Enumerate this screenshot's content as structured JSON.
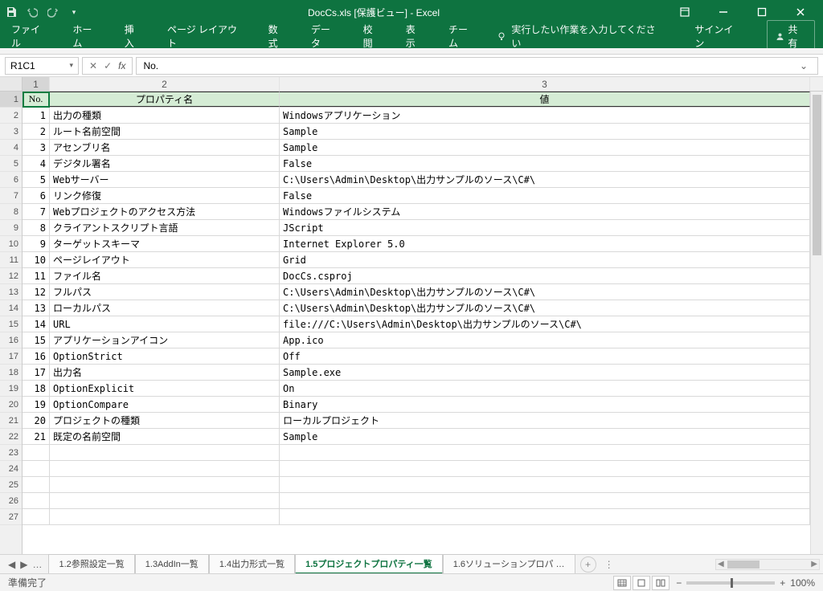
{
  "title": "DocCs.xls  [保護ビュー] - Excel",
  "ribbon": {
    "tabs": [
      "ファイル",
      "ホーム",
      "挿入",
      "ページ レイアウト",
      "数式",
      "データ",
      "校閲",
      "表示",
      "チーム"
    ],
    "tell": "実行したい作業を入力してください",
    "signin": "サインイン",
    "share": "共有"
  },
  "formula": {
    "name_box": "R1C1",
    "value": "No."
  },
  "col_headers": [
    "1",
    "2",
    "3"
  ],
  "hdr": {
    "c1": "No.",
    "c2": "プロパティ名",
    "c3": "値"
  },
  "rows": [
    {
      "n": "1",
      "p": "出力の種類",
      "v": "Windowsアプリケーション"
    },
    {
      "n": "2",
      "p": "ルート名前空間",
      "v": "Sample"
    },
    {
      "n": "3",
      "p": "アセンブリ名",
      "v": "Sample"
    },
    {
      "n": "4",
      "p": "デジタル署名",
      "v": "False"
    },
    {
      "n": "5",
      "p": "Webサーバー",
      "v": "C:\\Users\\Admin\\Desktop\\出力サンプルのソース\\C#\\"
    },
    {
      "n": "6",
      "p": "リンク修復",
      "v": "False"
    },
    {
      "n": "7",
      "p": "Webプロジェクトのアクセス方法",
      "v": "Windowsファイルシステム"
    },
    {
      "n": "8",
      "p": "クライアントスクリプト言語",
      "v": "JScript"
    },
    {
      "n": "9",
      "p": "ターゲットスキーマ",
      "v": "Internet Explorer 5.0"
    },
    {
      "n": "10",
      "p": "ページレイアウト",
      "v": "Grid"
    },
    {
      "n": "11",
      "p": "ファイル名",
      "v": "DocCs.csproj"
    },
    {
      "n": "12",
      "p": "フルパス",
      "v": "C:\\Users\\Admin\\Desktop\\出力サンプルのソース\\C#\\"
    },
    {
      "n": "13",
      "p": "ローカルパス",
      "v": "C:\\Users\\Admin\\Desktop\\出力サンプルのソース\\C#\\"
    },
    {
      "n": "14",
      "p": "URL",
      "v": "file:///C:\\Users\\Admin\\Desktop\\出力サンプルのソース\\C#\\"
    },
    {
      "n": "15",
      "p": "アプリケーションアイコン",
      "v": "App.ico"
    },
    {
      "n": "16",
      "p": "OptionStrict",
      "v": "Off"
    },
    {
      "n": "17",
      "p": "出力名",
      "v": "Sample.exe"
    },
    {
      "n": "18",
      "p": "OptionExplicit",
      "v": "On"
    },
    {
      "n": "19",
      "p": "OptionCompare",
      "v": "Binary"
    },
    {
      "n": "20",
      "p": "プロジェクトの種類",
      "v": "ローカルプロジェクト"
    },
    {
      "n": "21",
      "p": "既定の名前空間",
      "v": "Sample"
    }
  ],
  "empty_rows": 5,
  "sheet_tabs": {
    "items": [
      "1.2参照設定一覧",
      "1.3AddIn一覧",
      "1.4出力形式一覧",
      "1.5プロジェクトプロパティ一覧",
      "1.6ソリューションプロパ …"
    ],
    "active_index": 3,
    "ellipsis": "…"
  },
  "status": {
    "ready": "準備完了",
    "zoom": "100%"
  }
}
